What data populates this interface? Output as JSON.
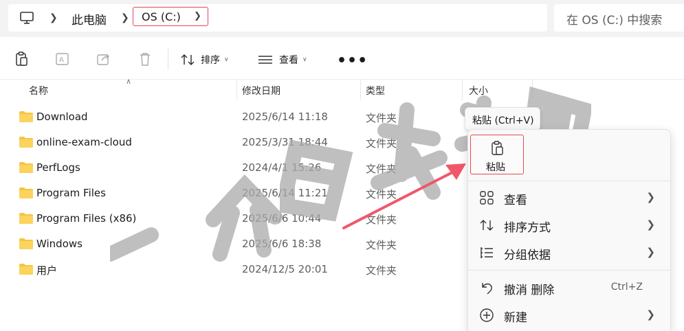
{
  "address": {
    "crumb_pc": "此电脑",
    "crumb_drive": "OS (C:)",
    "search_placeholder": "在 OS (C:) 中搜索"
  },
  "toolbar": {
    "sort_label": "排序",
    "view_label": "查看",
    "more_label": "•••"
  },
  "columns": {
    "name": "名称",
    "modified": "修改日期",
    "type": "类型",
    "size": "大小"
  },
  "files": [
    {
      "name": "Download",
      "date": "2025/6/14 11:18",
      "type": "文件夹"
    },
    {
      "name": "online-exam-cloud",
      "date": "2025/3/31 18:44",
      "type": "文件夹"
    },
    {
      "name": "PerfLogs",
      "date": "2024/4/1 15:26",
      "type": "文件夹"
    },
    {
      "name": "Program Files",
      "date": "2025/6/14 11:21",
      "type": "文件夹"
    },
    {
      "name": "Program Files (x86)",
      "date": "2025/6/6 10:44",
      "type": "文件夹"
    },
    {
      "name": "Windows",
      "date": "2025/6/6 18:38",
      "type": "文件夹"
    },
    {
      "name": "用户",
      "date": "2024/12/5 20:01",
      "type": "文件夹"
    }
  ],
  "tooltip": "粘贴 (Ctrl+V)",
  "context_menu": {
    "paste_label": "粘贴",
    "view": "查看",
    "sort_by": "排序方式",
    "group_by": "分组依据",
    "undo": "撤消 删除",
    "undo_shortcut": "Ctrl+Z",
    "new": "新建"
  },
  "watermark": "一介白衣专用",
  "colors": {
    "accent_red": "#e8474f",
    "folder_yellow": "#f4c542",
    "topbar_bg": "#f3f3f3"
  },
  "icons": [
    "pc-icon",
    "chevron-right-icon",
    "clipboard-icon",
    "rename-icon",
    "share-icon",
    "trash-icon",
    "sort-icon",
    "view-icon",
    "folder-icon",
    "grid-icon",
    "undo-icon",
    "plus-circle-icon"
  ]
}
